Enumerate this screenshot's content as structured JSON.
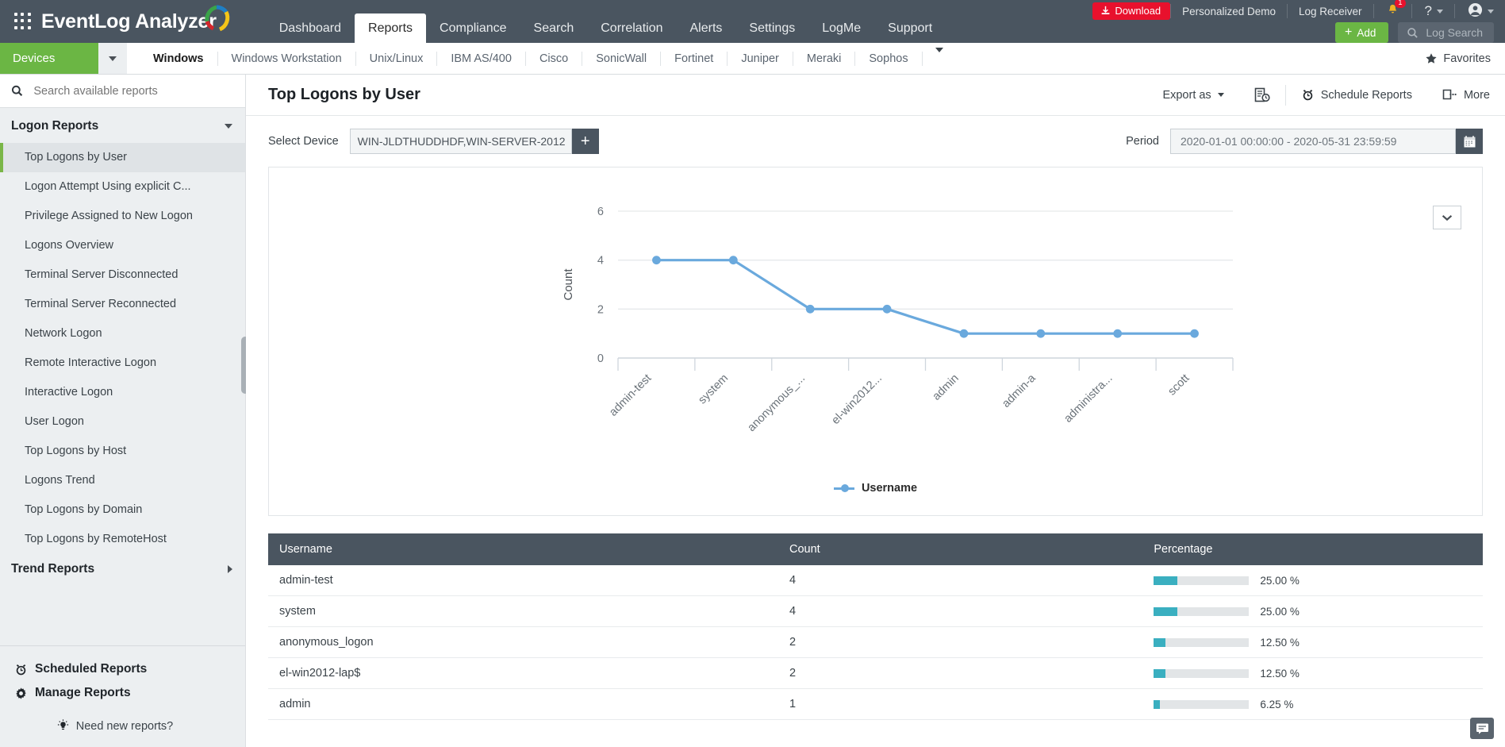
{
  "header": {
    "brand": "EventLog Analyzer",
    "nav": [
      {
        "label": "Dashboard",
        "active": false
      },
      {
        "label": "Reports",
        "active": true
      },
      {
        "label": "Compliance",
        "active": false
      },
      {
        "label": "Search",
        "active": false
      },
      {
        "label": "Correlation",
        "active": false
      },
      {
        "label": "Alerts",
        "active": false
      },
      {
        "label": "Settings",
        "active": false
      },
      {
        "label": "LogMe",
        "active": false
      },
      {
        "label": "Support",
        "active": false
      }
    ],
    "download_label": "Download",
    "personalized_demo": "Personalized Demo",
    "log_receiver": "Log Receiver",
    "notification_count": "1",
    "help_label": "?",
    "add_label": "Add",
    "log_search_placeholder": "Log Search"
  },
  "subbar": {
    "devices_label": "Devices",
    "tabs": [
      {
        "label": "Windows",
        "active": true
      },
      {
        "label": "Windows Workstation",
        "active": false
      },
      {
        "label": "Unix/Linux",
        "active": false
      },
      {
        "label": "IBM AS/400",
        "active": false
      },
      {
        "label": "Cisco",
        "active": false
      },
      {
        "label": "SonicWall",
        "active": false
      },
      {
        "label": "Fortinet",
        "active": false
      },
      {
        "label": "Juniper",
        "active": false
      },
      {
        "label": "Meraki",
        "active": false
      },
      {
        "label": "Sophos",
        "active": false
      }
    ],
    "favorites_label": "Favorites"
  },
  "sidebar": {
    "search_placeholder": "Search available reports",
    "section_logon": "Logon Reports",
    "items": [
      {
        "label": "Top Logons by User",
        "active": true
      },
      {
        "label": "Logon Attempt Using explicit C...",
        "active": false
      },
      {
        "label": "Privilege Assigned to New Logon",
        "active": false
      },
      {
        "label": "Logons Overview",
        "active": false
      },
      {
        "label": "Terminal Server Disconnected",
        "active": false
      },
      {
        "label": "Terminal Server Reconnected",
        "active": false
      },
      {
        "label": "Network Logon",
        "active": false
      },
      {
        "label": "Remote Interactive Logon",
        "active": false
      },
      {
        "label": "Interactive Logon",
        "active": false
      },
      {
        "label": "User Logon",
        "active": false
      },
      {
        "label": "Top Logons by Host",
        "active": false
      },
      {
        "label": "Logons Trend",
        "active": false
      },
      {
        "label": "Top Logons by Domain",
        "active": false
      },
      {
        "label": "Top Logons by RemoteHost",
        "active": false
      }
    ],
    "section_trend": "Trend Reports",
    "scheduled_reports": "Scheduled Reports",
    "manage_reports": "Manage Reports",
    "need_new_reports": "Need new reports?"
  },
  "content": {
    "title": "Top Logons by User",
    "export_as": "Export as",
    "schedule_reports": "Schedule Reports",
    "more": "More",
    "select_device_label": "Select Device",
    "select_device_value": "WIN-JLDTHUDDHDF,WIN-SERVER-2012",
    "period_label": "Period",
    "period_value": "2020-01-01 00:00:00 - 2020-05-31 23:59:59"
  },
  "chart_data": {
    "type": "line",
    "title": "",
    "xlabel": "",
    "ylabel": "Count",
    "categories": [
      "admin-test",
      "system",
      "anonymous_...",
      "el-win2012...",
      "admin",
      "admin-a",
      "administra...",
      "scott"
    ],
    "values": [
      4,
      4,
      2,
      2,
      1,
      1,
      1,
      1
    ],
    "series": [
      {
        "name": "Username",
        "values": [
          4,
          4,
          2,
          2,
          1,
          1,
          1,
          1
        ]
      }
    ],
    "ylim": [
      0,
      6
    ],
    "yticks": [
      0,
      2,
      4,
      6
    ],
    "legend": [
      "Username"
    ],
    "legend_position": "bottom",
    "grid": true,
    "color": "#6aa9dd"
  },
  "table": {
    "columns": [
      "Username",
      "Count",
      "Percentage"
    ],
    "rows": [
      {
        "username": "admin-test",
        "count": "4",
        "percentage": "25.00 %",
        "pct": 25
      },
      {
        "username": "system",
        "count": "4",
        "percentage": "25.00 %",
        "pct": 25
      },
      {
        "username": "anonymous_logon",
        "count": "2",
        "percentage": "12.50 %",
        "pct": 12.5
      },
      {
        "username": "el-win2012-lap$",
        "count": "2",
        "percentage": "12.50 %",
        "pct": 12.5
      },
      {
        "username": "admin",
        "count": "1",
        "percentage": "6.25 %",
        "pct": 6.25
      }
    ]
  },
  "colors": {
    "header_bg": "#4a5560",
    "accent_green": "#6bb644",
    "download_red": "#e8112d",
    "chart_blue": "#6aa9dd",
    "bar_teal": "#3aafc0"
  }
}
